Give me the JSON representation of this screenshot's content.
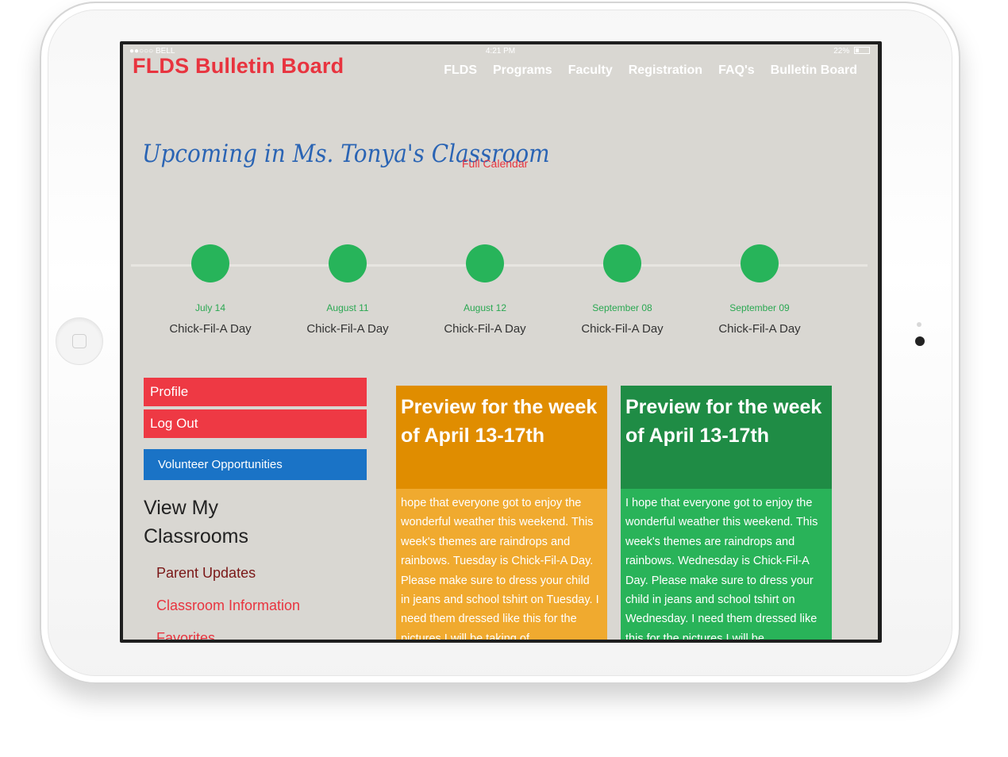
{
  "status_bar": {
    "carrier": "●●○○○ BELL",
    "time": "4:21 PM",
    "battery": "22%"
  },
  "site": {
    "logo": "FLDS Bulletin Board",
    "nav": [
      "FLDS",
      "Programs",
      "Faculty",
      "Registration",
      "FAQ's",
      "Bulletin Board"
    ]
  },
  "classroom": {
    "heading": "Upcoming in Ms. Tonya's Classroom",
    "full_calendar": "Full Calendar"
  },
  "events": [
    {
      "date": "July 14",
      "title": "Chick-Fil-A Day"
    },
    {
      "date": "August 11",
      "title": "Chick-Fil-A Day"
    },
    {
      "date": "August 12",
      "title": "Chick-Fil-A Day"
    },
    {
      "date": "September 08",
      "title": "Chick-Fil-A Day"
    },
    {
      "date": "September 09",
      "title": "Chick-Fil-A Day"
    }
  ],
  "sidebar": {
    "profile": "Profile",
    "logout": "Log Out",
    "volunteer": "Volunteer Opportunities",
    "view_heading": "View My Classrooms",
    "links": [
      "Parent Updates",
      "Classroom Information",
      "Favorites"
    ]
  },
  "cards": [
    {
      "title": "Preview for the week of April 13-17th",
      "body": "hope that everyone got to enjoy the wonderful weather this weekend. This week's themes are raindrops and rainbows. Tuesday is Chick-Fil-A Day. Please make sure to dress your child in jeans and school tshirt on Tuesday. I need them dressed like this for the pictures I will be taking of"
    },
    {
      "title": "Preview for the week of April 13-17th",
      "body": "I hope that everyone got to enjoy the wonderful weather this weekend. This week's themes are raindrops and rainbows. Wednesday is Chick-Fil-A Day. Please make sure to dress your child in jeans and school tshirt on Wednesday. I need them dressed like this for the pictures I will be"
    }
  ],
  "colors": {
    "accent_red": "#e8343f",
    "accent_blue": "#1a73c6",
    "event_green": "#27b45a",
    "card_orange": "#f0aa2f",
    "card_green": "#29b359"
  }
}
